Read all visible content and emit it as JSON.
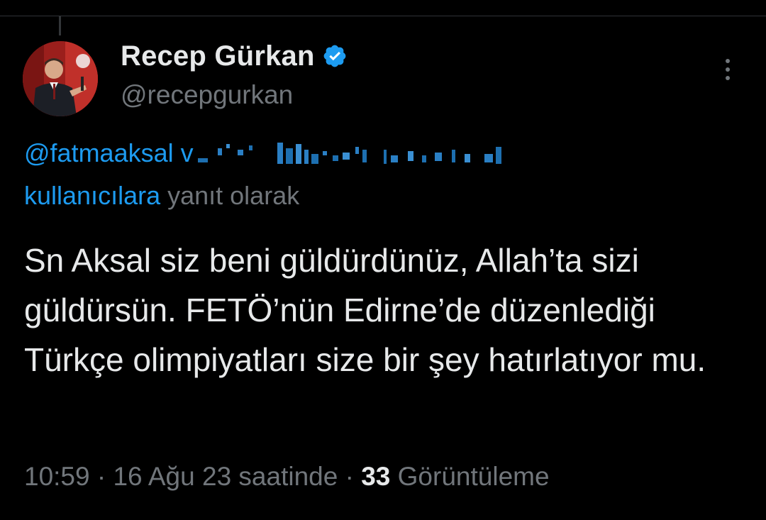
{
  "tweet": {
    "author": {
      "display_name": "Recep Gürkan",
      "handle": "@recepgurkan",
      "verified": true,
      "verified_icon": "verified-badge-icon"
    },
    "reply_context": {
      "mention": "@fatmaaksal",
      "connector": "v",
      "users_label": "kullanıcılara",
      "suffix": "yanıt olarak"
    },
    "text": "Sn Aksal siz beni güldürdünüz, Allah’ta sizi güldürsün. FETÖ’nün Edirne’de düzenlediği Türkçe olimpiyatları size bir şey hatırlatıyor mu.",
    "meta": {
      "time": "10:59",
      "separator": "·",
      "date_phrase": "16 Ağu 23 saatinde",
      "views_count": "33",
      "views_label": "Görüntüleme"
    },
    "more_icon": "more-vertical-icon"
  },
  "colors": {
    "background": "#000000",
    "text_primary": "#e7e9ea",
    "text_secondary": "#71767b",
    "link": "#1d9bf0",
    "verified": "#1d9bf0",
    "divider": "#2f3336"
  }
}
